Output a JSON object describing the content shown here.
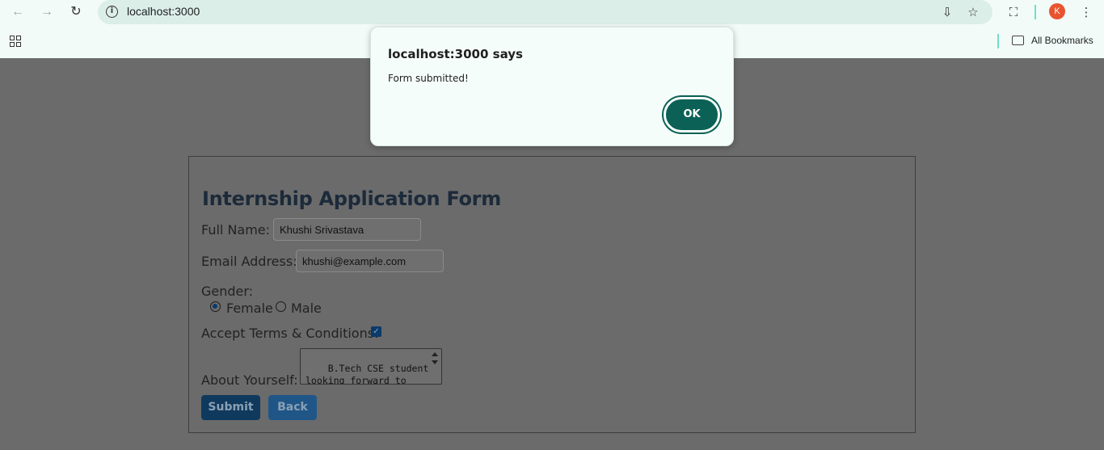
{
  "browser": {
    "url": "localhost:3000",
    "profile_initial": "K",
    "bookmarks_label": "All Bookmarks",
    "icons": [
      "back-arrow-icon",
      "forward-arrow-icon",
      "reload-icon",
      "site-info-icon",
      "install-app-icon",
      "star-icon",
      "extensions-icon",
      "menu-icon",
      "apps-grid-icon",
      "folder-icon"
    ]
  },
  "dialog": {
    "title": "localhost:3000 says",
    "message": "Form submitted!",
    "ok_label": "OK",
    "accent": "#0b6155"
  },
  "form": {
    "title": "Internship Application Form",
    "full_name_label": "Full Name:",
    "full_name_value": "Khushi Srivastava",
    "email_label": "Email Address:",
    "email_value": "khushi@example.com",
    "gender_label": "Gender:",
    "gender_options": [
      "Female",
      "Male"
    ],
    "gender_selected": "Female",
    "terms_label": "Accept Terms & Conditions:",
    "terms_checked": true,
    "about_label": "About Yourself:",
    "about_value": "B.Tech CSE student\nlooking forward to\ngaining internship",
    "submit_label": "Submit",
    "back_label": "Back"
  }
}
